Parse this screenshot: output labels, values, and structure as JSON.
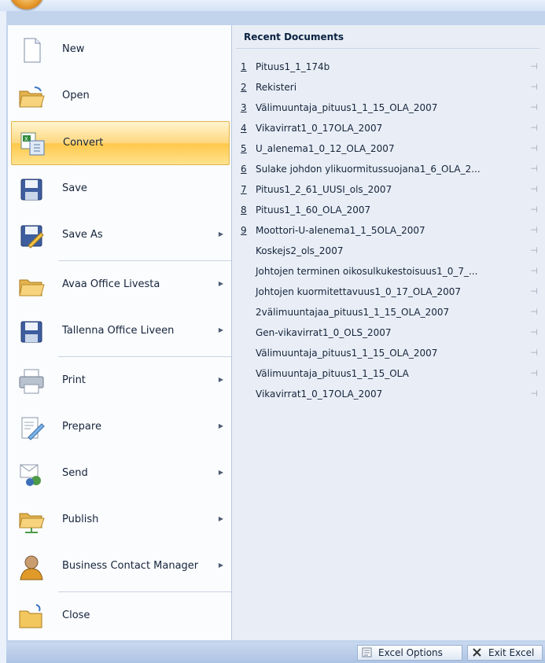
{
  "menu": {
    "items": [
      {
        "label": "New",
        "icon": "new-document-icon",
        "submenu": false
      },
      {
        "label": "Open",
        "icon": "open-folder-icon",
        "submenu": false
      },
      {
        "label": "Convert",
        "icon": "convert-icon",
        "submenu": false
      },
      {
        "label": "Save",
        "icon": "save-icon",
        "submenu": false
      },
      {
        "label": "Save As",
        "icon": "save-as-icon",
        "submenu": true
      },
      {
        "label": "Avaa Office Livesta",
        "icon": "folder-icon",
        "submenu": true
      },
      {
        "label": "Tallenna Office Liveen",
        "icon": "save-icon",
        "submenu": true
      },
      {
        "label": "Print",
        "icon": "printer-icon",
        "submenu": true
      },
      {
        "label": "Prepare",
        "icon": "prepare-icon",
        "submenu": true
      },
      {
        "label": "Send",
        "icon": "send-icon",
        "submenu": true
      },
      {
        "label": "Publish",
        "icon": "publish-icon",
        "submenu": true
      },
      {
        "label": "Business Contact Manager",
        "icon": "contact-manager-icon",
        "submenu": true
      },
      {
        "label": "Close",
        "icon": "close-folder-icon",
        "submenu": false
      }
    ]
  },
  "recent": {
    "title": "Recent Documents",
    "items": [
      {
        "num": "1",
        "name": "Pituus1_1_174b"
      },
      {
        "num": "2",
        "name": "Rekisteri"
      },
      {
        "num": "3",
        "name": "Välimuuntaja_pituus1_1_15_OLA_2007"
      },
      {
        "num": "4",
        "name": "Vikavirrat1_0_17OLA_2007"
      },
      {
        "num": "5",
        "name": "U_alenema1_0_12_OLA_2007"
      },
      {
        "num": "6",
        "name": "Sulake johdon ylikuormitussuojana1_6_OLA_2..."
      },
      {
        "num": "7",
        "name": "Pituus1_2_61_UUSI_ols_2007"
      },
      {
        "num": "8",
        "name": "Pituus1_1_60_OLA_2007"
      },
      {
        "num": "9",
        "name": "Moottori-U-alenema1_1_5OLA_2007"
      },
      {
        "num": "",
        "name": "Koskejs2_ols_2007"
      },
      {
        "num": "",
        "name": "Johtojen terminen oikosulkukestoisuus1_0_7_..."
      },
      {
        "num": "",
        "name": "Johtojen kuormitettavuus1_0_17_OLA_2007"
      },
      {
        "num": "",
        "name": "2välimuuntajaa_pituus1_1_15_OLA_2007"
      },
      {
        "num": "",
        "name": "Gen-vikavirrat1_0_OLS_2007"
      },
      {
        "num": "",
        "name": "Välimuuntaja_pituus1_1_15_OLA_2007"
      },
      {
        "num": "",
        "name": "Välimuuntaja_pituus1_1_15_OLA"
      },
      {
        "num": "",
        "name": "Vikavirrat1_0_17OLA_2007"
      }
    ]
  },
  "footer": {
    "options_label": "Excel Options",
    "exit_label": "Exit Excel"
  },
  "colors": {
    "highlight": "#ffd77f",
    "pane": "#e9eef6",
    "frame": "#c2d4ec"
  }
}
